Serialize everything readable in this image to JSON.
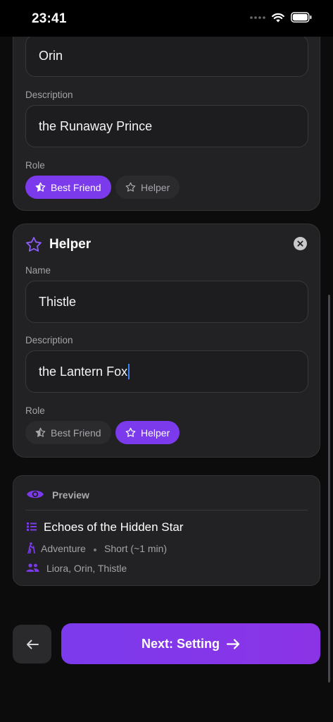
{
  "status_bar": {
    "time": "23:41"
  },
  "card1": {
    "name_value": "Orin",
    "description_label": "Description",
    "description_value": "the Runaway Prince",
    "role_label": "Role",
    "roles": [
      {
        "label": "Best Friend",
        "selected": true
      },
      {
        "label": "Helper",
        "selected": false
      }
    ]
  },
  "card2": {
    "title": "Helper",
    "name_label": "Name",
    "name_value": "Thistle",
    "description_label": "Description",
    "description_value": "the Lantern Fox",
    "role_label": "Role",
    "roles": [
      {
        "label": "Best Friend",
        "selected": false
      },
      {
        "label": "Helper",
        "selected": true
      }
    ]
  },
  "preview": {
    "heading": "Preview",
    "title": "Echoes of the Hidden Star",
    "genre": "Adventure",
    "length": "Short (~1 min)",
    "characters": "Liora, Orin, Thistle"
  },
  "footer": {
    "next_label": "Next: Setting"
  },
  "colors": {
    "accent": "#7c3aed",
    "background": "#0c0c0d",
    "card": "#222224"
  }
}
